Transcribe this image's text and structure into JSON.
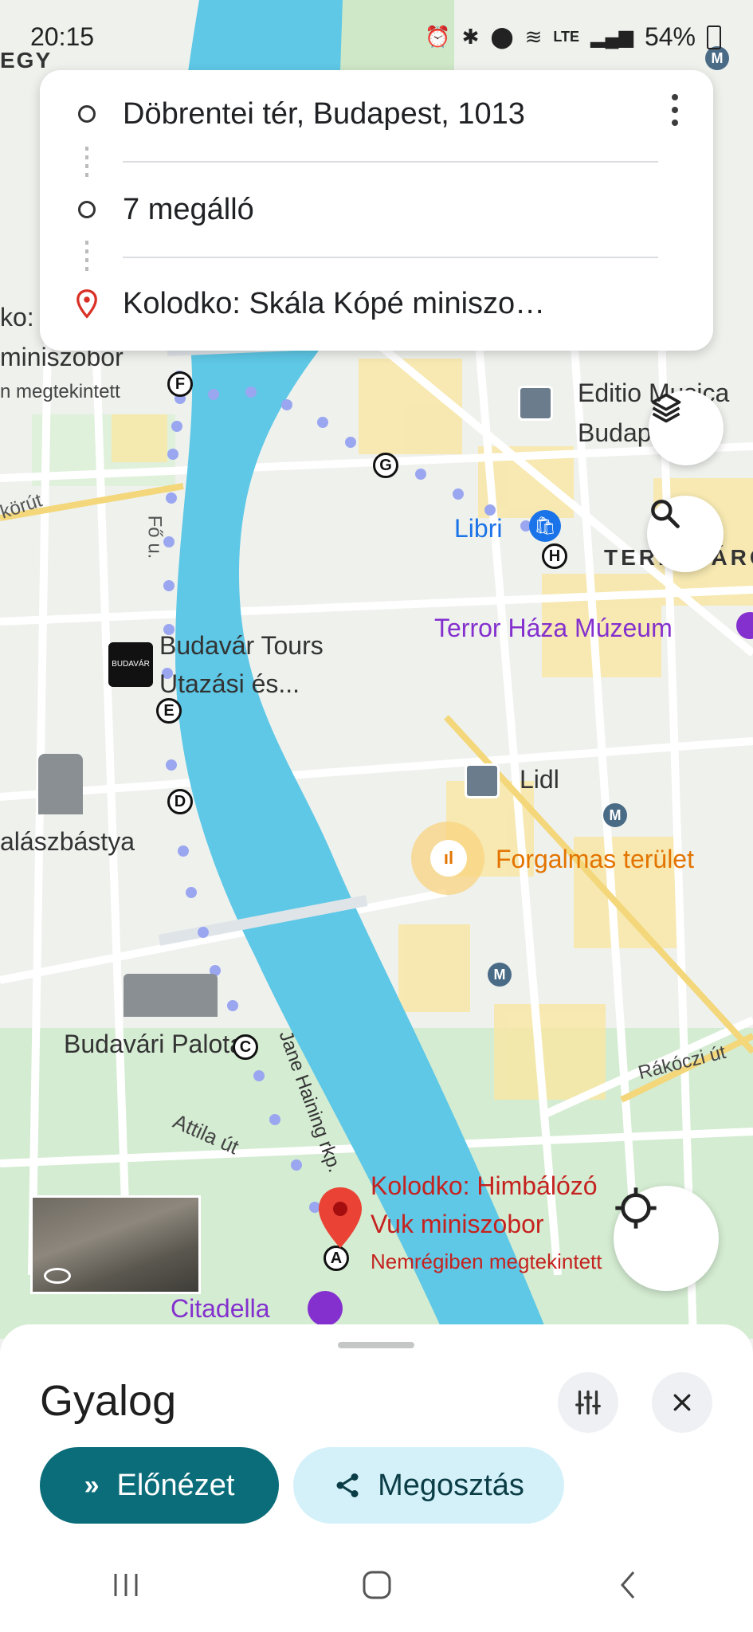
{
  "status_bar": {
    "time": "20:15",
    "battery": "54%",
    "network": "LTE",
    "icons": [
      "alarm-icon",
      "bluetooth-icon",
      "location-icon",
      "wifi-icon",
      "signal-icon",
      "battery-icon"
    ]
  },
  "route_card": {
    "origin": "Döbrentei tér, Budapest, 1013",
    "stops": "7 megálló",
    "destination": "Kolodko: Skála Kópé miniszo…",
    "more_icon": "more-vert-icon"
  },
  "map": {
    "labels": {
      "edge_top_left": "EGY",
      "left_top_1": "ko:",
      "left_top_2": "miniszobor",
      "left_top_3": "n megtekintett",
      "street_korut": "körút",
      "street_fo": "Fő u.",
      "editio_1": "Editio Musica",
      "editio_2": "Budapest Ze",
      "libri": "Libri",
      "terezvaros": "TERÉZVÁROS",
      "terror": "Terror Háza Múzeum",
      "budavar_1": "Budavár Tours",
      "budavar_2": "Utazási és...",
      "lidl": "Lidl",
      "halaszbastya": "alászbástya",
      "forgalmas": "Forgalmas terület",
      "jane": "Jane Haining rkp.",
      "budavari_palota": "Budavári Palota",
      "rakoczi": "Rákóczi út",
      "attila": "Attila út",
      "dest_1": "Kolodko: Himbálózó",
      "dest_2": "Vuk miniszobor",
      "dest_3": "Nemrégiben megtekintett",
      "citadella": "Citadella",
      "metro": "M"
    },
    "stops": [
      "A",
      "C",
      "D",
      "E",
      "F",
      "G",
      "H"
    ],
    "colors": {
      "water": "#5ec8e6",
      "route_dots": "#9aa7f0",
      "busy": "#e37400",
      "poi_purple": "#8430ce",
      "poi_red": "#c5221f",
      "shopping": "#1a73e8"
    }
  },
  "bottom_sheet": {
    "mode": "Gyalog",
    "preview_label": "Előnézet",
    "share_label": "Megosztás",
    "filter_icon": "tune-icon",
    "close_icon": "close-icon"
  }
}
